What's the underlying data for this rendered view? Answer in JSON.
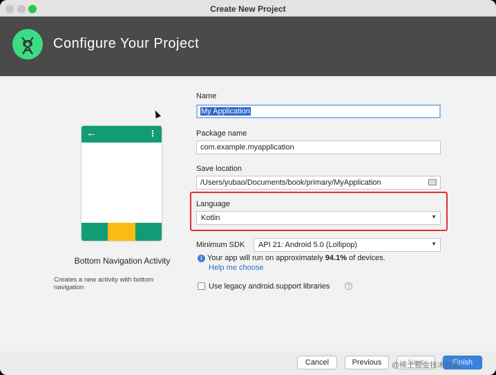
{
  "window": {
    "title": "Create New Project",
    "traffic_colors": {
      "close": "#c7c7c7",
      "minimize": "#c7c7c7",
      "maximize": "#2bc840"
    }
  },
  "header": {
    "title": "Configure Your Project",
    "logo_icon": "android-studio-icon",
    "background_color": "#4a4a4a"
  },
  "template": {
    "name": "Bottom Navigation Activity",
    "description": "Creates a new activity with bottom navigation",
    "back_glyph": "←",
    "menu_glyph": "⋮",
    "primary_color": "#129c75",
    "accent_color": "#f8bc15"
  },
  "form": {
    "name_label": "Name",
    "name_value": "My Application",
    "package_label": "Package name",
    "package_value": "com.example.myapplication",
    "save_label": "Save location",
    "save_value": "/Users/yubao/Documents/book/primary/MyApplication",
    "language_label": "Language",
    "language_value": "Kotlin",
    "min_sdk_label": "Minimum SDK",
    "min_sdk_value": "API 21: Android 5.0 (Lollipop)",
    "info_prefix": "Your app will run on approximately ",
    "info_percent": "94.1%",
    "info_suffix": " of devices.",
    "help_link": "Help me choose",
    "legacy_label": "Use legacy android.support libraries",
    "legacy_checked": false,
    "info_glyph": "i",
    "help_glyph": "?",
    "dropdown_glyph": "▼",
    "highlight_color": "#e03030"
  },
  "footer": {
    "cancel": "Cancel",
    "previous": "Previous",
    "next": "Next",
    "finish": "Finish",
    "watermark": "@稀土掘金技术社区"
  }
}
